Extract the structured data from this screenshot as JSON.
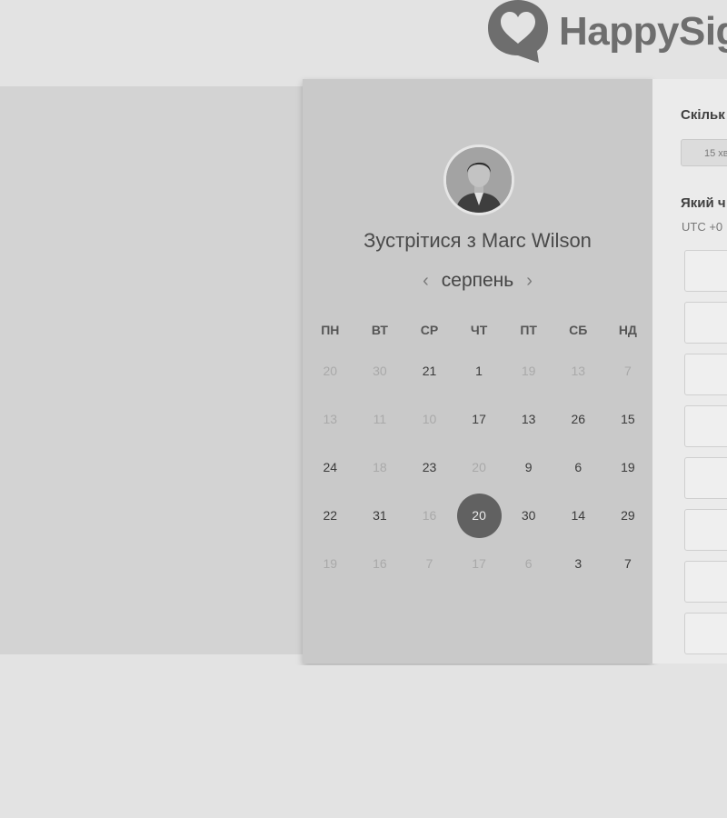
{
  "brand": {
    "logo_text": "HappySig"
  },
  "booking": {
    "title": "Зустрітися з Marc Wilson",
    "month": "серпень",
    "prev_icon": "‹",
    "next_icon": "›",
    "weekdays": [
      "ПН",
      "ВТ",
      "СР",
      "ЧТ",
      "ПТ",
      "СБ",
      "НД"
    ],
    "weeks": [
      [
        {
          "d": "20",
          "s": "disabled"
        },
        {
          "d": "30",
          "s": "disabled"
        },
        {
          "d": "21",
          "s": "enabled"
        },
        {
          "d": "1",
          "s": "enabled"
        },
        {
          "d": "19",
          "s": "disabled"
        },
        {
          "d": "13",
          "s": "disabled"
        },
        {
          "d": "7",
          "s": "disabled"
        }
      ],
      [
        {
          "d": "13",
          "s": "disabled"
        },
        {
          "d": "11",
          "s": "disabled"
        },
        {
          "d": "10",
          "s": "disabled"
        },
        {
          "d": "17",
          "s": "enabled"
        },
        {
          "d": "13",
          "s": "enabled"
        },
        {
          "d": "26",
          "s": "enabled"
        },
        {
          "d": "15",
          "s": "enabled"
        }
      ],
      [
        {
          "d": "24",
          "s": "enabled"
        },
        {
          "d": "18",
          "s": "disabled"
        },
        {
          "d": "23",
          "s": "enabled"
        },
        {
          "d": "20",
          "s": "disabled"
        },
        {
          "d": "9",
          "s": "enabled"
        },
        {
          "d": "6",
          "s": "enabled"
        },
        {
          "d": "19",
          "s": "enabled"
        }
      ],
      [
        {
          "d": "22",
          "s": "enabled"
        },
        {
          "d": "31",
          "s": "enabled"
        },
        {
          "d": "16",
          "s": "disabled"
        },
        {
          "d": "20",
          "s": "selected"
        },
        {
          "d": "30",
          "s": "enabled"
        },
        {
          "d": "14",
          "s": "enabled"
        },
        {
          "d": "29",
          "s": "enabled"
        }
      ],
      [
        {
          "d": "19",
          "s": "disabled"
        },
        {
          "d": "16",
          "s": "disabled"
        },
        {
          "d": "7",
          "s": "disabled"
        },
        {
          "d": "17",
          "s": "disabled"
        },
        {
          "d": "6",
          "s": "disabled"
        },
        {
          "d": "3",
          "s": "enabled"
        },
        {
          "d": "7",
          "s": "enabled"
        }
      ]
    ]
  },
  "options": {
    "duration_question": "Скільк",
    "duration_value": "15 хв",
    "time_question": "Який ч",
    "timezone": "UTC +0",
    "slot_count": 8
  },
  "colors": {
    "selected_day": "#616161",
    "card": "#c9c9c9"
  }
}
